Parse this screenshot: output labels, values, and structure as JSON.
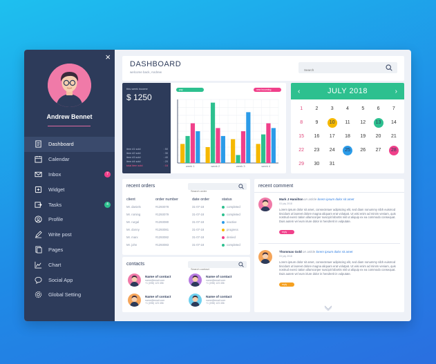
{
  "user": {
    "name": "Andrew Bennet"
  },
  "colors": {
    "sidebar": "#2d3b5a",
    "accent_green": "#2dc08f",
    "accent_pink": "#f0408a",
    "accent_blue": "#2b7be0",
    "accent_yellow": "#f5b800"
  },
  "sidebar": {
    "close_label": "×",
    "items": [
      {
        "label": "Dashboard",
        "icon": "document-icon"
      },
      {
        "label": "Calendar",
        "icon": "calendar-icon"
      },
      {
        "label": "Inbox",
        "icon": "mail-icon",
        "badge": "7"
      },
      {
        "label": "Widget",
        "icon": "widget-icon"
      },
      {
        "label": "Tasks",
        "icon": "tasks-icon",
        "badge": "4"
      },
      {
        "label": "Profile",
        "icon": "profile-icon"
      },
      {
        "label": "Write post",
        "icon": "pen-icon"
      },
      {
        "label": "Pages",
        "icon": "pages-icon"
      },
      {
        "label": "Chart",
        "icon": "chart-icon"
      },
      {
        "label": "Social App",
        "icon": "chat-icon"
      },
      {
        "label": "Global Setting",
        "icon": "gear-icon"
      }
    ]
  },
  "header": {
    "title": "DASHBOARD",
    "subtitle": "welcome back, Andrew",
    "search_placeholder": "Search"
  },
  "stats": {
    "week_label": "this week income",
    "amount": "$ 1250",
    "pill_left": "pay",
    "pill_right": "new incoming",
    "rows": [
      {
        "label": "item #1 sold",
        "value": ": 50"
      },
      {
        "label": "item #2 sold",
        "value": ": 30"
      },
      {
        "label": "item #3 sold",
        "value": ": 40"
      },
      {
        "label": "item #4 sold",
        "value": ": 20"
      },
      {
        "label": "total item sold",
        "value": ": 16"
      }
    ]
  },
  "chart_data": {
    "type": "bar",
    "categories": [
      "week 1",
      "week 2",
      "week 3",
      "week 4"
    ],
    "series": [
      {
        "color": "#f5b800",
        "values": [
          24,
          20,
          30,
          24
        ]
      },
      {
        "color": "#2dc08f",
        "values": [
          34,
          76,
          10,
          36
        ]
      },
      {
        "color": "#f0408a",
        "values": [
          50,
          44,
          40,
          50
        ]
      },
      {
        "color": "#2b9be8",
        "values": [
          40,
          34,
          64,
          44
        ]
      }
    ],
    "ylim": [
      0,
      80
    ],
    "grid": true
  },
  "calendar": {
    "month": "JULY 2018",
    "prev": "‹",
    "next": "›",
    "weeks": [
      [
        "1",
        "2",
        "3",
        "4",
        "5",
        "6",
        "7"
      ],
      [
        "8",
        "9",
        "10",
        "11",
        "12",
        "13",
        "14"
      ],
      [
        "15",
        "16",
        "17",
        "18",
        "19",
        "20",
        "21"
      ],
      [
        "22",
        "23",
        "24",
        "25",
        "26",
        "27",
        "28"
      ],
      [
        "29",
        "30",
        "31",
        "",
        "",
        "",
        ""
      ]
    ],
    "highlights": {
      "10": "#f5b800",
      "13": "#2dc08f",
      "25": "#2b9be8",
      "28": "#f0408a"
    }
  },
  "orders": {
    "title": "recent orders",
    "search_placeholder": "Search order",
    "columns": [
      "client",
      "order number",
      "date order",
      "status"
    ],
    "rows": [
      {
        "client": "Mr. daniels",
        "number": "#1293078",
        "date": "31-07-18",
        "status": "completed",
        "color": "#2dc08f"
      },
      {
        "client": "Mr. roming",
        "number": "#1293079",
        "date": "31-07-18",
        "status": "completed",
        "color": "#2dc08f"
      },
      {
        "client": "Mr. rurgal",
        "number": "#1293080",
        "date": "31-07-18",
        "status": "inactive",
        "color": "#2b9be8"
      },
      {
        "client": "Mr. donny",
        "number": "#1293081",
        "date": "31-07-18",
        "status": "progress",
        "color": "#f5b800"
      },
      {
        "client": "Mr. marx",
        "number": "#1293082",
        "date": "31-07-18",
        "status": "denied",
        "color": "#f0408a"
      },
      {
        "client": "Mr. john",
        "number": "#1293083",
        "date": "31-07-18",
        "status": "completed",
        "color": "#2dc08f"
      }
    ]
  },
  "contacts": {
    "title": "contacts",
    "search_placeholder": "Search contact",
    "items": [
      {
        "name": "Name of contact",
        "email": "name@email.com",
        "phone": "+1 (098) 123 456",
        "bg": "#f07aa8"
      },
      {
        "name": "Name of contact",
        "email": "name@email.com",
        "phone": "+1 (098) 123 456",
        "bg": "#b67ae0"
      },
      {
        "name": "Name of contact",
        "email": "name@email.com",
        "phone": "+1 (098) 123 456",
        "bg": "#f5a55a"
      },
      {
        "name": "Name of contact",
        "email": "name@email.com",
        "phone": "+1 (098) 123 456",
        "bg": "#6fd0ef"
      }
    ]
  },
  "comments": {
    "title": "recent comment",
    "items": [
      {
        "author": "Mark J Hamilton",
        "on": "on article",
        "article": "lorem ipsum dolor sit amet",
        "date": "03 july 2018",
        "text": "Lorem ipsum dolor sit amet, consectetuer adipiscing elit, sed diam nonummy nibh euismod tincidunt ut laoreet dolore magna aliquam erat volutpat. Ut wisi enim ad minim veniam, quis nostrud exerci tation ullamcorper suscipit lobortis nisl ut aliquip ex ea commodo consequat. Duis autem vel eum iriure dolor in hendrerit in vulputate.",
        "reply": "reply",
        "reply_color": "#f0408a",
        "avatar_bg": "#f07aa8"
      },
      {
        "author": "Thommas Gold",
        "on": "on article",
        "article": "lorem ipsum dolor sit amet",
        "date": "03 july 2018",
        "text": "Lorem ipsum dolor sit amet, consectetuer adipiscing elit, sed diam nonummy nibh euismod tincidunt ut laoreet dolore magna aliquam erat volutpat. Ut wisi enim ad minim veniam, quis nostrud exerci tation ullamcorper suscipit lobortis nisl ut aliquip ex ea commodo consequat. Duis autem vel eum iriure dolor in hendrerit in vulputate.",
        "reply": "reply",
        "reply_color": "#f5a020",
        "avatar_bg": "#f5a55a"
      }
    ]
  }
}
